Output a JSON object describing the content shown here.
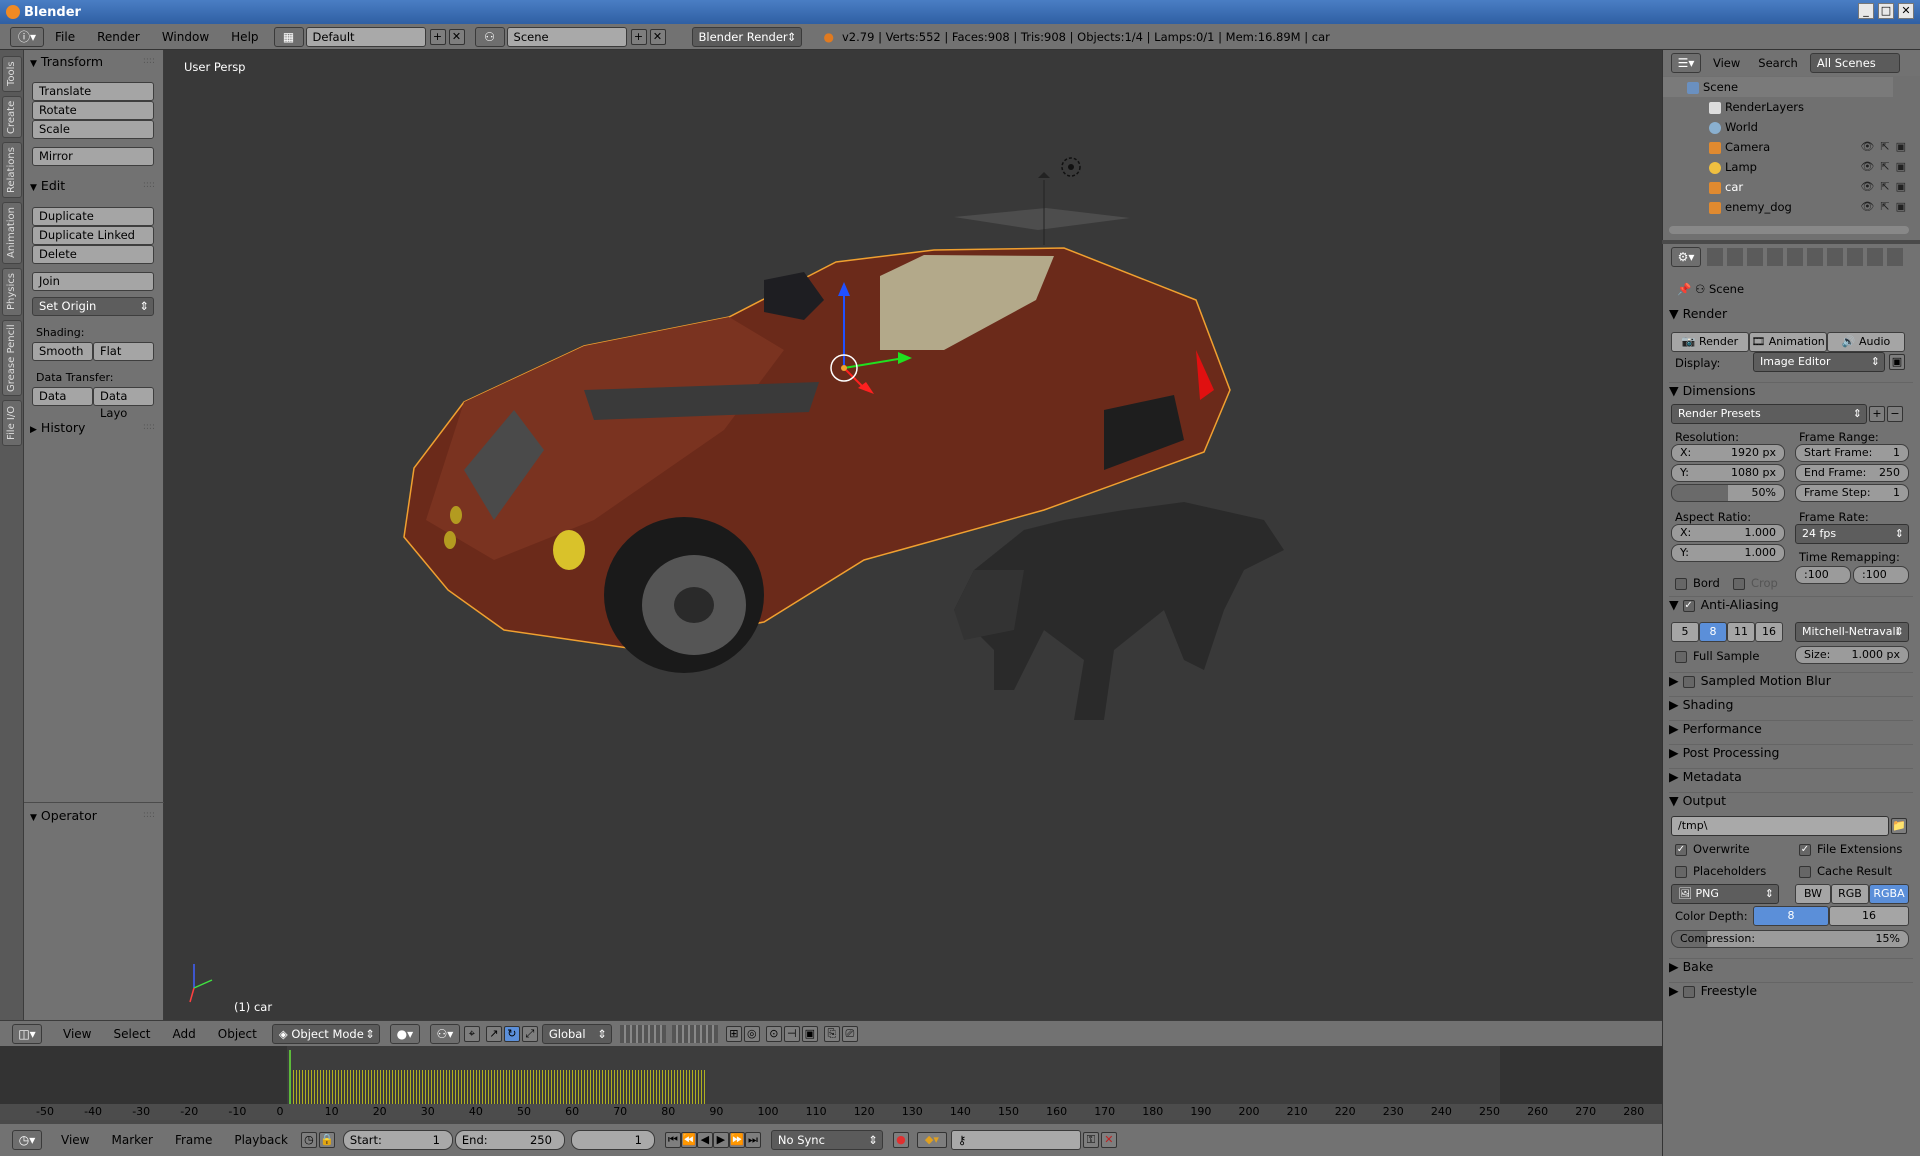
{
  "window": {
    "title": "Blender"
  },
  "menubar": {
    "menus": [
      "File",
      "Render",
      "Window",
      "Help"
    ],
    "layout": "Default",
    "scene": "Scene",
    "engine": "Blender Render",
    "stats": "v2.79 | Verts:552 | Faces:908 | Tris:908 | Objects:1/4 | Lamps:0/1 | Mem:16.89M | car"
  },
  "vtabs": [
    "Tools",
    "Create",
    "Relations",
    "Animation",
    "Physics",
    "Grease Pencil",
    "File I/O"
  ],
  "toolshelf": {
    "transform_title": "Transform",
    "translate": "Translate",
    "rotate": "Rotate",
    "scale": "Scale",
    "mirror": "Mirror",
    "edit_title": "Edit",
    "duplicate": "Duplicate",
    "duplicate_linked": "Duplicate Linked",
    "delete": "Delete",
    "join": "Join",
    "set_origin": "Set Origin",
    "shading_label": "Shading:",
    "smooth": "Smooth",
    "flat": "Flat",
    "data_transfer_label": "Data Transfer:",
    "data": "Data",
    "data_layo": "Data Layo",
    "history_title": "History",
    "operator_title": "Operator"
  },
  "viewport": {
    "view_label": "User Persp",
    "object_label": "(1) car"
  },
  "header3d": {
    "menus": [
      "View",
      "Select",
      "Add",
      "Object"
    ],
    "mode": "Object Mode",
    "orientation": "Global"
  },
  "timeline": {
    "ticks": [
      "-50",
      "-40",
      "-30",
      "-20",
      "-10",
      "0",
      "10",
      "20",
      "30",
      "40",
      "50",
      "60",
      "70",
      "80",
      "90",
      "100",
      "110",
      "120",
      "130",
      "140",
      "150",
      "160",
      "170",
      "180",
      "190",
      "200",
      "210",
      "220",
      "230",
      "240",
      "250",
      "260",
      "270",
      "280"
    ],
    "menus": [
      "View",
      "Marker",
      "Frame",
      "Playback"
    ],
    "start_label": "Start:",
    "start": "1",
    "end_label": "End:",
    "end": "250",
    "current": "1",
    "sync": "No Sync"
  },
  "outliner": {
    "menus": [
      "View",
      "Search"
    ],
    "filter": "All Scenes",
    "items": [
      "Scene",
      "RenderLayers",
      "World",
      "Camera",
      "Lamp",
      "car",
      "enemy_dog"
    ]
  },
  "props": {
    "context": "Scene",
    "render_title": "Render",
    "render_btn": "Render",
    "animation_btn": "Animation",
    "audio_btn": "Audio",
    "display_label": "Display:",
    "display_value": "Image Editor",
    "dimensions_title": "Dimensions",
    "render_presets": "Render Presets",
    "resolution_label": "Resolution:",
    "res_x": "1920 px",
    "res_y": "1080 px",
    "res_pct": "50%",
    "frame_range_label": "Frame Range:",
    "start_frame_label": "Start Frame:",
    "start_frame": "1",
    "end_frame_label": "End Frame:",
    "end_frame": "250",
    "frame_step_label": "Frame Step:",
    "frame_step": "1",
    "aspect_label": "Aspect Ratio:",
    "aspect_x": "1.000",
    "aspect_y": "1.000",
    "frame_rate_label": "Frame Rate:",
    "frame_rate": "24 fps",
    "time_remap_label": "Time Remapping:",
    "remap_old": ":100",
    "remap_new": ":100",
    "bord": "Bord",
    "crop": "Crop",
    "aa_title": "Anti-Aliasing",
    "aa_5": "5",
    "aa_8": "8",
    "aa_11": "11",
    "aa_16": "16",
    "aa_filter": "Mitchell-Netravali",
    "full_sample": "Full Sample",
    "size_label": "Size:",
    "size": "1.000 px",
    "motion_blur_title": "Sampled Motion Blur",
    "shading_title": "Shading",
    "performance_title": "Performance",
    "post_title": "Post Processing",
    "metadata_title": "Metadata",
    "output_title": "Output",
    "output_path": "/tmp\\",
    "overwrite": "Overwrite",
    "file_ext": "File Extensions",
    "placeholders": "Placeholders",
    "cache_result": "Cache Result",
    "format": "PNG",
    "bw": "BW",
    "rgb": "RGB",
    "rgba": "RGBA",
    "color_depth_label": "Color Depth:",
    "depth_8": "8",
    "depth_16": "16",
    "compression_label": "Compression:",
    "compression": "15%",
    "bake_title": "Bake",
    "freestyle_title": "Freestyle"
  }
}
